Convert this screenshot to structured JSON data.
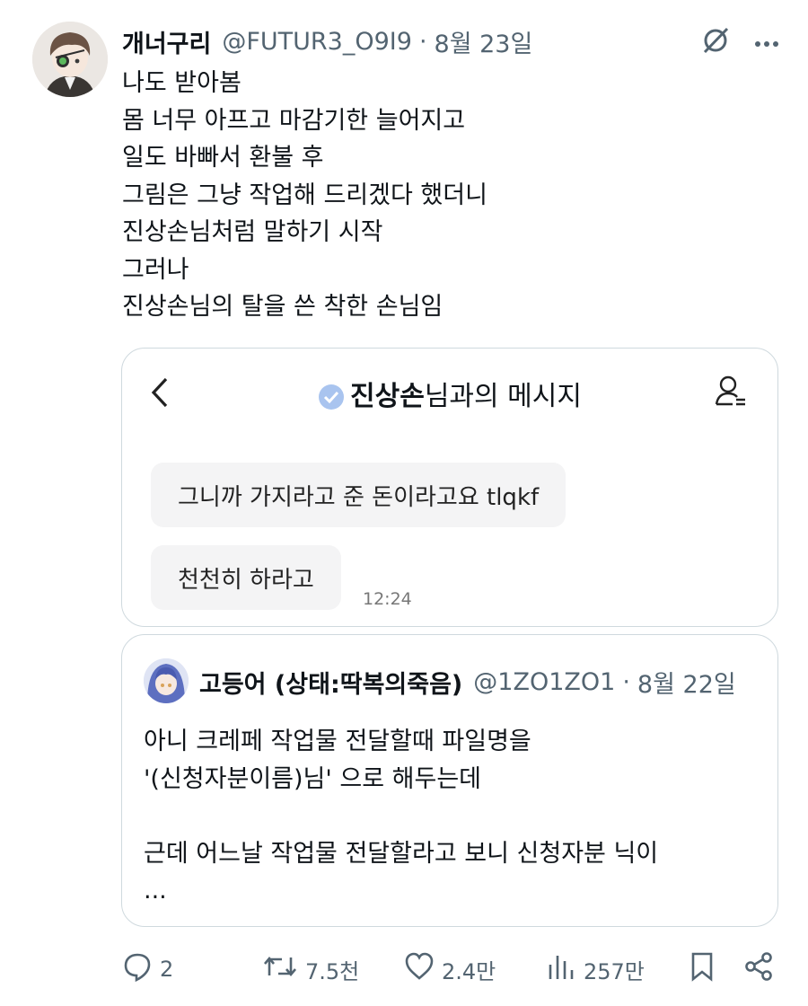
{
  "tweet": {
    "author_name": "개너구리",
    "author_handle": "@FUTUR3_O9I9",
    "date": "8월 23일",
    "lines": [
      "나도 받아봄",
      "몸 너무 아프고 마감기한 늘어지고",
      "일도 바빠서 환불 후",
      "그림은 그냥 작업해 드리겠다 했더니",
      "진상손님처럼 말하기 시작",
      "그러나",
      "진상손님의 탈을 쓴 착한 손님임"
    ]
  },
  "dm_screenshot": {
    "title_bold": "진상손",
    "title_rest": "님과의 메시지",
    "messages": [
      {
        "text": "그니까 가지라고 준 돈이라고요 tlqkf"
      },
      {
        "text": "천천히 하라고"
      }
    ],
    "time": "12:24"
  },
  "quote": {
    "author_name": "고등어 (상태:딱복의죽음)",
    "author_handle": "@1ZO1ZO1",
    "date": "8월 22일",
    "lines": [
      "아니 크레페 작업물 전달할때 파일명을",
      "'(신청자분이름)님' 으로 해두는데",
      "",
      "근데 어느날 작업물 전달할라고 보니 신청자분 닉이",
      "..."
    ]
  },
  "actions": {
    "replies": "2",
    "reposts": "7.5천",
    "likes": "2.4만",
    "views": "257만"
  },
  "icons": {
    "more": "more-icon",
    "grok": "grok-icon",
    "reply": "reply-icon",
    "repost": "repost-icon",
    "like": "heart-icon",
    "views": "views-icon",
    "bookmark": "bookmark-icon",
    "share": "share-icon"
  },
  "colors": {
    "text": "#0f1419",
    "secondary": "#536471",
    "border": "#cfd9de",
    "verified": "#a9c4ef"
  }
}
